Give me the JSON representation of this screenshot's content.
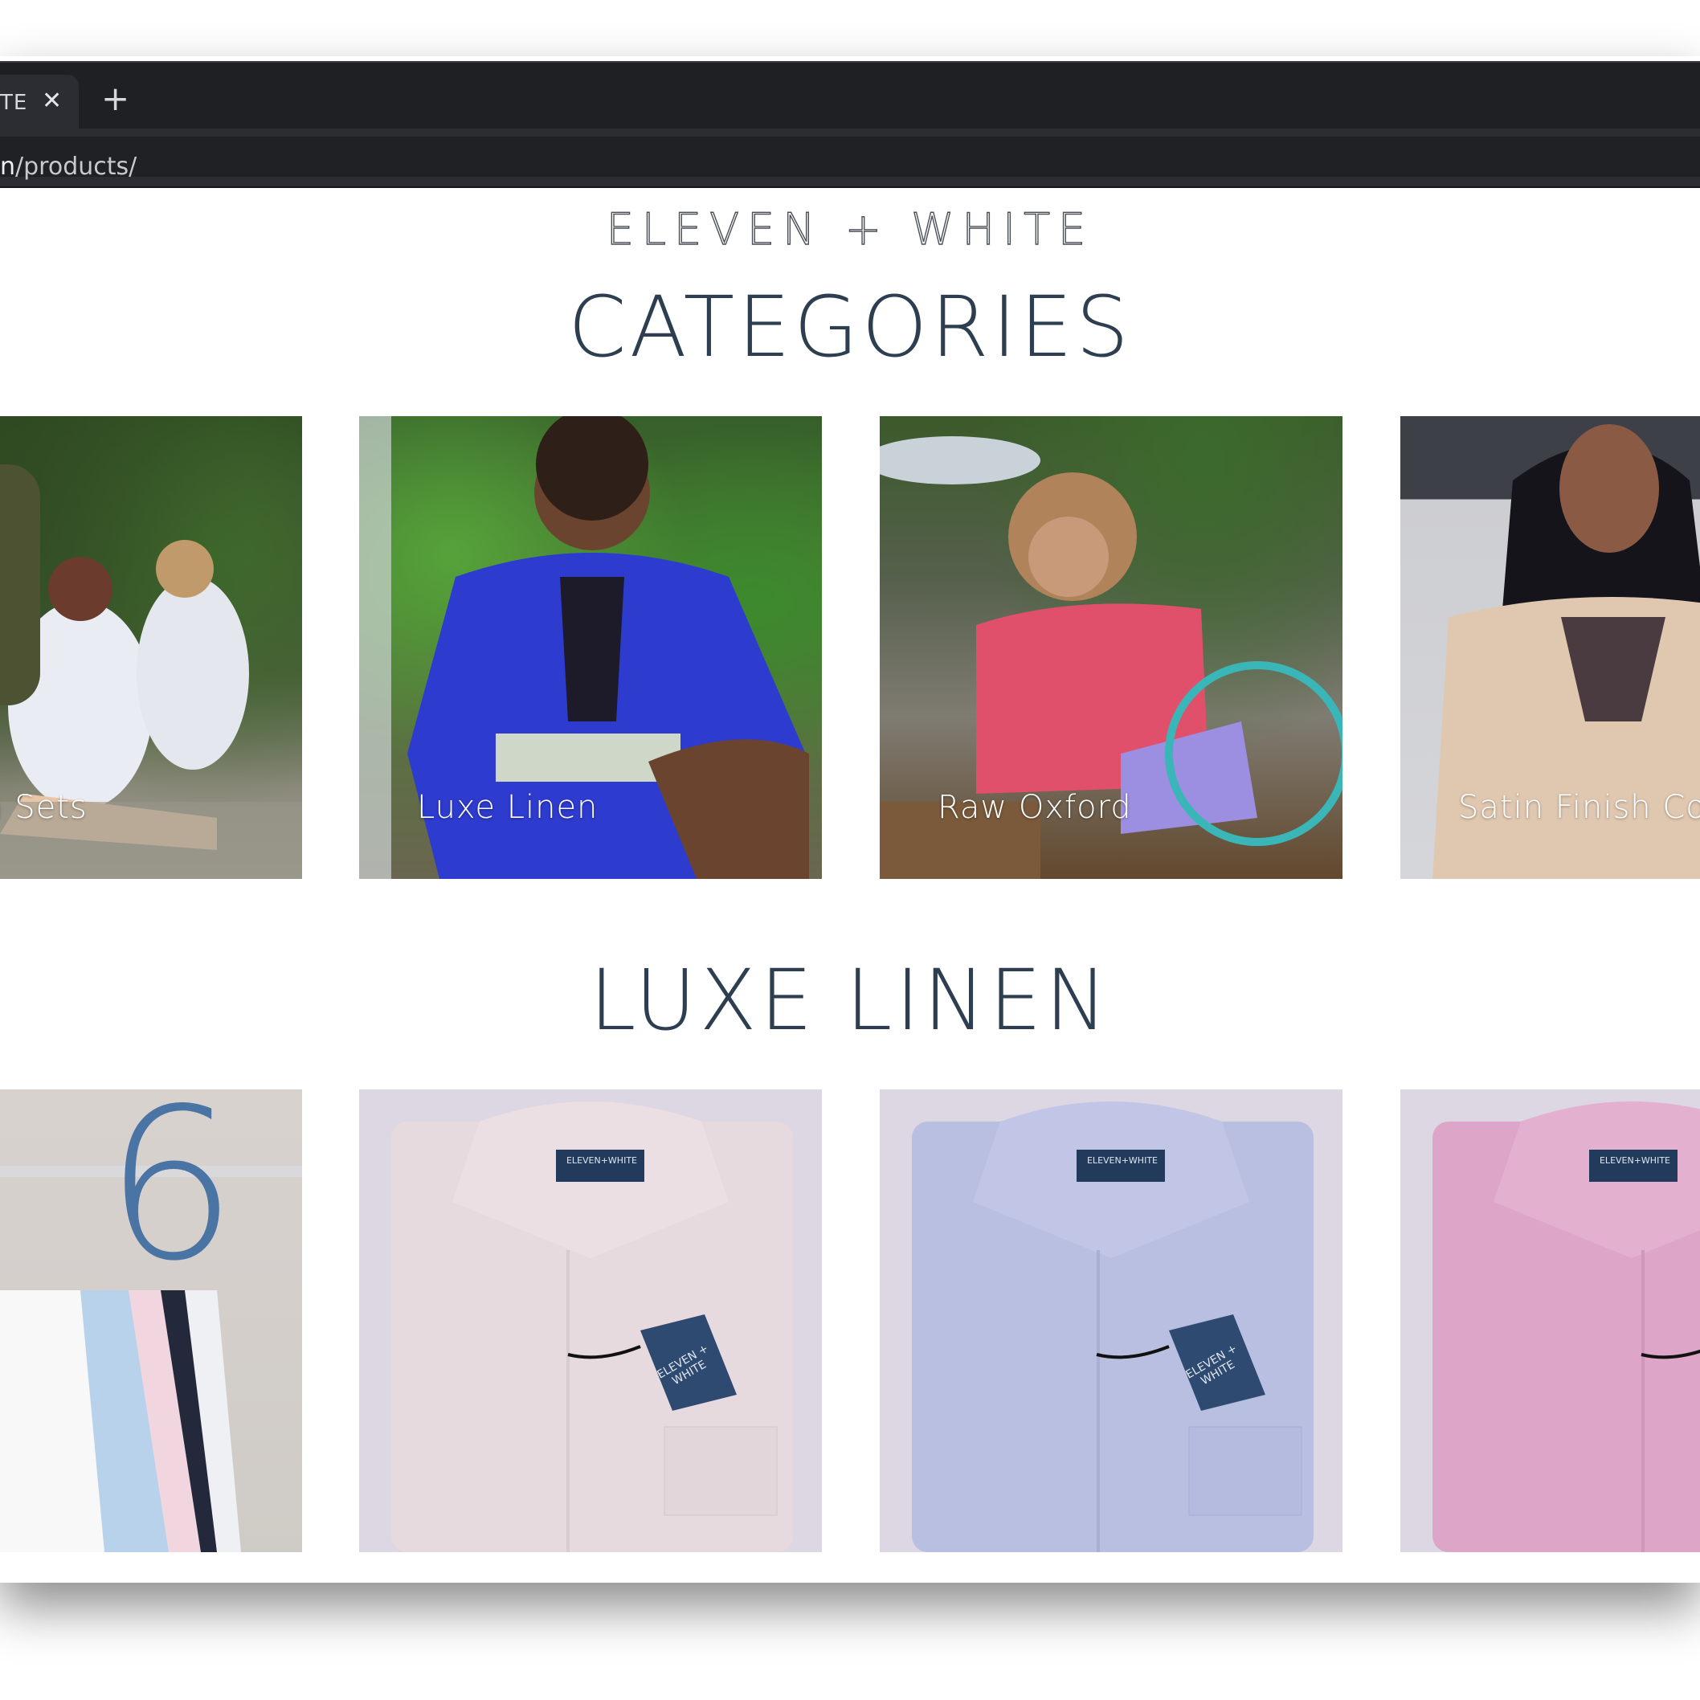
{
  "browser": {
    "tab_title": "TE",
    "tab_close_glyph": "✕",
    "new_tab_glyph": "+",
    "url_host": "n",
    "url_path": "/products/"
  },
  "site": {
    "logo": "ELEVEN + WHITE"
  },
  "categories": {
    "title": "CATEGORIES",
    "items": [
      {
        "label": "nation Sets"
      },
      {
        "label": "Luxe Linen"
      },
      {
        "label": "Raw Oxford"
      },
      {
        "label": "Satin Finish Cot"
      }
    ]
  },
  "luxe_linen": {
    "title": "LUXE LINEN",
    "count_badge": "6",
    "shirt_label": "ELEVEN+WHITE",
    "hang_tag": "ELEVEN + WHITE"
  },
  "colors": {
    "title_text": "#2c3e50",
    "badge_blue": "#4a74a4",
    "chrome_dark": "#1f2024"
  }
}
